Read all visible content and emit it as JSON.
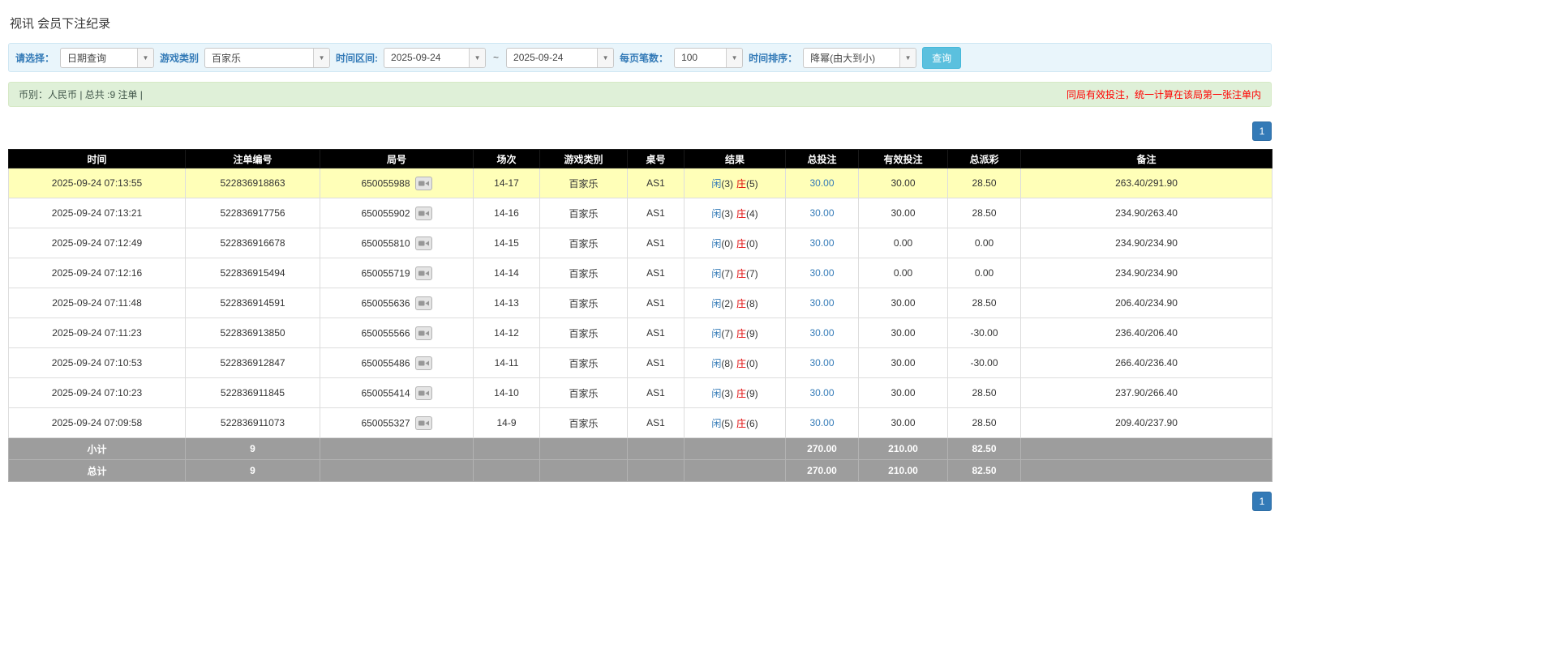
{
  "page": {
    "title": "视讯 会员下注纪录"
  },
  "filters": {
    "select_label": "请选择：",
    "select_value": "日期查询",
    "game_type_label": "游戏类别",
    "game_type_value": "百家乐",
    "time_range_label": "时间区间:",
    "time_from": "2025-09-24",
    "time_separator": "~",
    "time_to": "2025-09-24",
    "page_size_label": "每页笔数：",
    "page_size_value": "100",
    "sort_label": "时间排序：",
    "sort_value": "降幂(由大到小)",
    "search_button": "查询"
  },
  "summary": {
    "left": "币别：人民币 | 总共 :9 注单 |",
    "right": "同局有效投注，统一计算在该局第一张注单内"
  },
  "pagination": {
    "page": "1"
  },
  "icons": {
    "dropdown": "chevron-down-icon",
    "round": "video-replay-icon"
  },
  "colors": {
    "header_bg": "#000000",
    "highlight_row": "#ffffb8",
    "link_blue": "#337ab7",
    "player_blue": "#337ab7",
    "banker_red": "#e00000",
    "negative_red": "#e00000",
    "warning_red": "#ff0000",
    "search_button_bg": "#5bc0de",
    "pager_bg": "#337ab7",
    "footer_gray": "#9d9d9d",
    "filter_bar_bg": "#e9f5fb",
    "summary_bar_bg": "#dff0d8"
  },
  "table": {
    "headers": [
      "时间",
      "注单编号",
      "局号",
      "场次",
      "游戏类别",
      "桌号",
      "结果",
      "总投注",
      "有效投注",
      "总派彩",
      "备注"
    ],
    "rows": [
      {
        "time": "2025-09-24 07:13:55",
        "bet_id": "522836918863",
        "round": "650055988",
        "session": "14-17",
        "game": "百家乐",
        "table_no": "AS1",
        "player": "闲",
        "player_score": "(3)",
        "banker": "庄",
        "banker_score": "(5)",
        "total_bet": "30.00",
        "valid_bet": "30.00",
        "payout": "28.50",
        "note": "263.40/291.90",
        "highlighted": true
      },
      {
        "time": "2025-09-24 07:13:21",
        "bet_id": "522836917756",
        "round": "650055902",
        "session": "14-16",
        "game": "百家乐",
        "table_no": "AS1",
        "player": "闲",
        "player_score": "(3)",
        "banker": "庄",
        "banker_score": "(4)",
        "total_bet": "30.00",
        "valid_bet": "30.00",
        "payout": "28.50",
        "note": "234.90/263.40",
        "highlighted": false
      },
      {
        "time": "2025-09-24 07:12:49",
        "bet_id": "522836916678",
        "round": "650055810",
        "session": "14-15",
        "game": "百家乐",
        "table_no": "AS1",
        "player": "闲",
        "player_score": "(0)",
        "banker": "庄",
        "banker_score": "(0)",
        "total_bet": "30.00",
        "valid_bet": "0.00",
        "payout": "0.00",
        "note": "234.90/234.90",
        "highlighted": false
      },
      {
        "time": "2025-09-24 07:12:16",
        "bet_id": "522836915494",
        "round": "650055719",
        "session": "14-14",
        "game": "百家乐",
        "table_no": "AS1",
        "player": "闲",
        "player_score": "(7)",
        "banker": "庄",
        "banker_score": "(7)",
        "total_bet": "30.00",
        "valid_bet": "0.00",
        "payout": "0.00",
        "note": "234.90/234.90",
        "highlighted": false
      },
      {
        "time": "2025-09-24 07:11:48",
        "bet_id": "522836914591",
        "round": "650055636",
        "session": "14-13",
        "game": "百家乐",
        "table_no": "AS1",
        "player": "闲",
        "player_score": "(2)",
        "banker": "庄",
        "banker_score": "(8)",
        "total_bet": "30.00",
        "valid_bet": "30.00",
        "payout": "28.50",
        "note": "206.40/234.90",
        "highlighted": false
      },
      {
        "time": "2025-09-24 07:11:23",
        "bet_id": "522836913850",
        "round": "650055566",
        "session": "14-12",
        "game": "百家乐",
        "table_no": "AS1",
        "player": "闲",
        "player_score": "(7)",
        "banker": "庄",
        "banker_score": "(9)",
        "total_bet": "30.00",
        "valid_bet": "30.00",
        "payout": "-30.00",
        "note": "236.40/206.40",
        "highlighted": false
      },
      {
        "time": "2025-09-24 07:10:53",
        "bet_id": "522836912847",
        "round": "650055486",
        "session": "14-11",
        "game": "百家乐",
        "table_no": "AS1",
        "player": "闲",
        "player_score": "(8)",
        "banker": "庄",
        "banker_score": "(0)",
        "total_bet": "30.00",
        "valid_bet": "30.00",
        "payout": "-30.00",
        "note": "266.40/236.40",
        "highlighted": false
      },
      {
        "time": "2025-09-24 07:10:23",
        "bet_id": "522836911845",
        "round": "650055414",
        "session": "14-10",
        "game": "百家乐",
        "table_no": "AS1",
        "player": "闲",
        "player_score": "(3)",
        "banker": "庄",
        "banker_score": "(9)",
        "total_bet": "30.00",
        "valid_bet": "30.00",
        "payout": "28.50",
        "note": "237.90/266.40",
        "highlighted": false
      },
      {
        "time": "2025-09-24 07:09:58",
        "bet_id": "522836911073",
        "round": "650055327",
        "session": "14-9",
        "game": "百家乐",
        "table_no": "AS1",
        "player": "闲",
        "player_score": "(5)",
        "banker": "庄",
        "banker_score": "(6)",
        "total_bet": "30.00",
        "valid_bet": "30.00",
        "payout": "28.50",
        "note": "209.40/237.90",
        "highlighted": false
      }
    ],
    "footer_rows": [
      {
        "label": "小计",
        "count": "9",
        "total_bet": "270.00",
        "valid_bet": "210.00",
        "payout": "82.50"
      },
      {
        "label": "总计",
        "count": "9",
        "total_bet": "270.00",
        "valid_bet": "210.00",
        "payout": "82.50"
      }
    ]
  }
}
